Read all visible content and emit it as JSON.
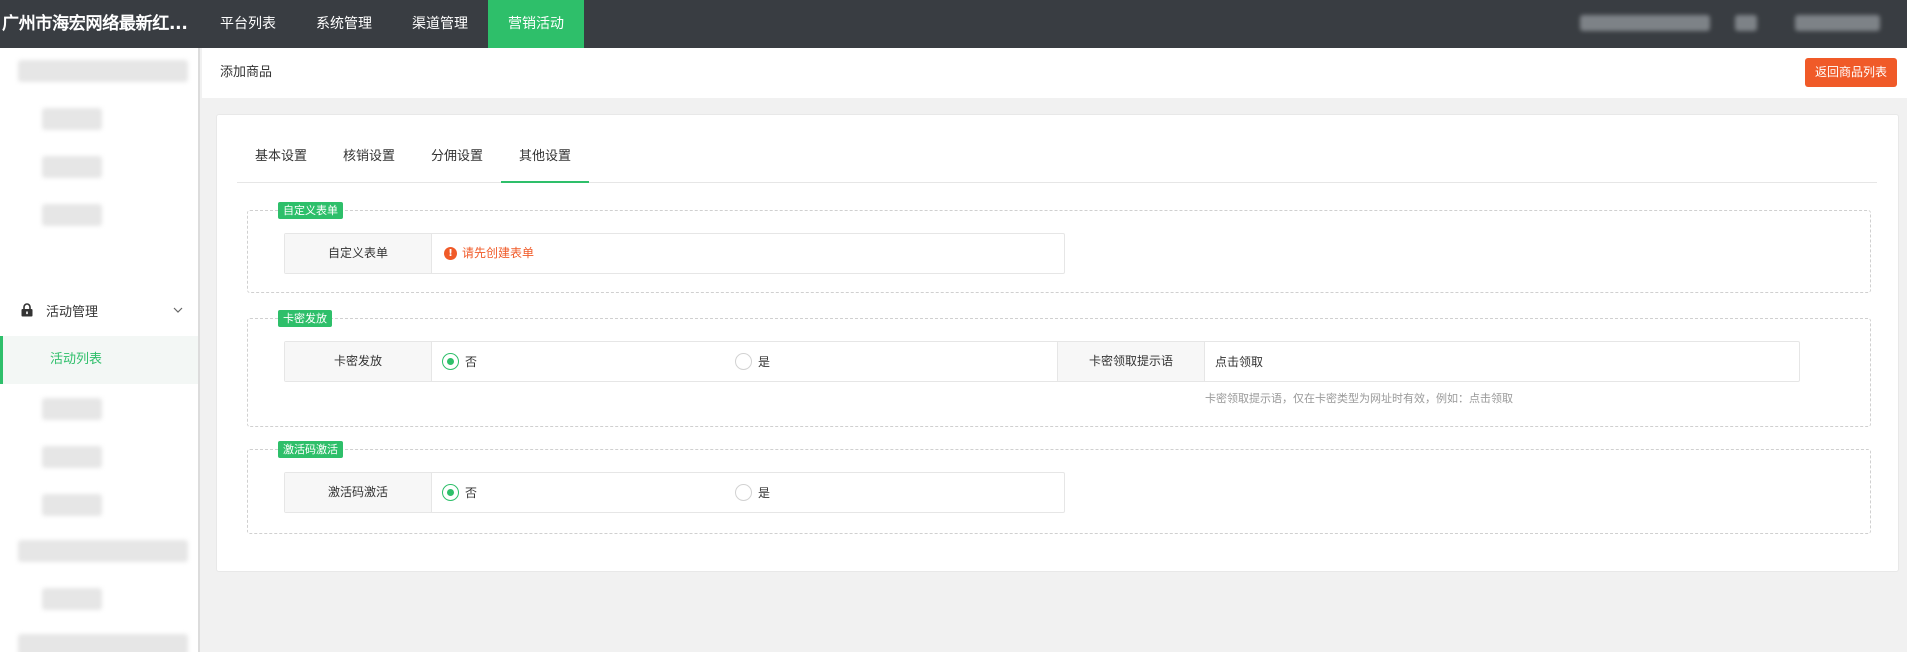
{
  "brand": {
    "title": "广州市海宏网络最新红..."
  },
  "top_nav": {
    "items": [
      {
        "label": "平台列表"
      },
      {
        "label": "系统管理"
      },
      {
        "label": "渠道管理"
      },
      {
        "label": "营销活动"
      }
    ],
    "active_index": 3
  },
  "sidebar": {
    "group_label": "活动管理",
    "active_sub_label": "活动列表"
  },
  "page": {
    "title": "添加商品",
    "back_button": "返回商品列表"
  },
  "tabs": [
    {
      "label": "基本设置"
    },
    {
      "label": "核销设置"
    },
    {
      "label": "分佣设置"
    },
    {
      "label": "其他设置"
    }
  ],
  "sections": {
    "custom_form": {
      "legend": "自定义表单",
      "label": "自定义表单",
      "warning": "请先创建表单"
    },
    "card_issue": {
      "legend": "卡密发放",
      "label": "卡密发放",
      "options": [
        "否",
        "是"
      ],
      "selected": "否",
      "tip_label": "卡密领取提示语",
      "tip_value": "点击领取",
      "tip_hint": "卡密领取提示语，仅在卡密类型为网址时有效，例如：点击领取"
    },
    "activation_code": {
      "legend": "激活码激活",
      "label": "激活码激活",
      "options": [
        "否",
        "是"
      ],
      "selected": "否"
    }
  },
  "colors": {
    "accent": "#2ebf6a",
    "topbar": "#393d42",
    "danger": "#f05a28"
  }
}
